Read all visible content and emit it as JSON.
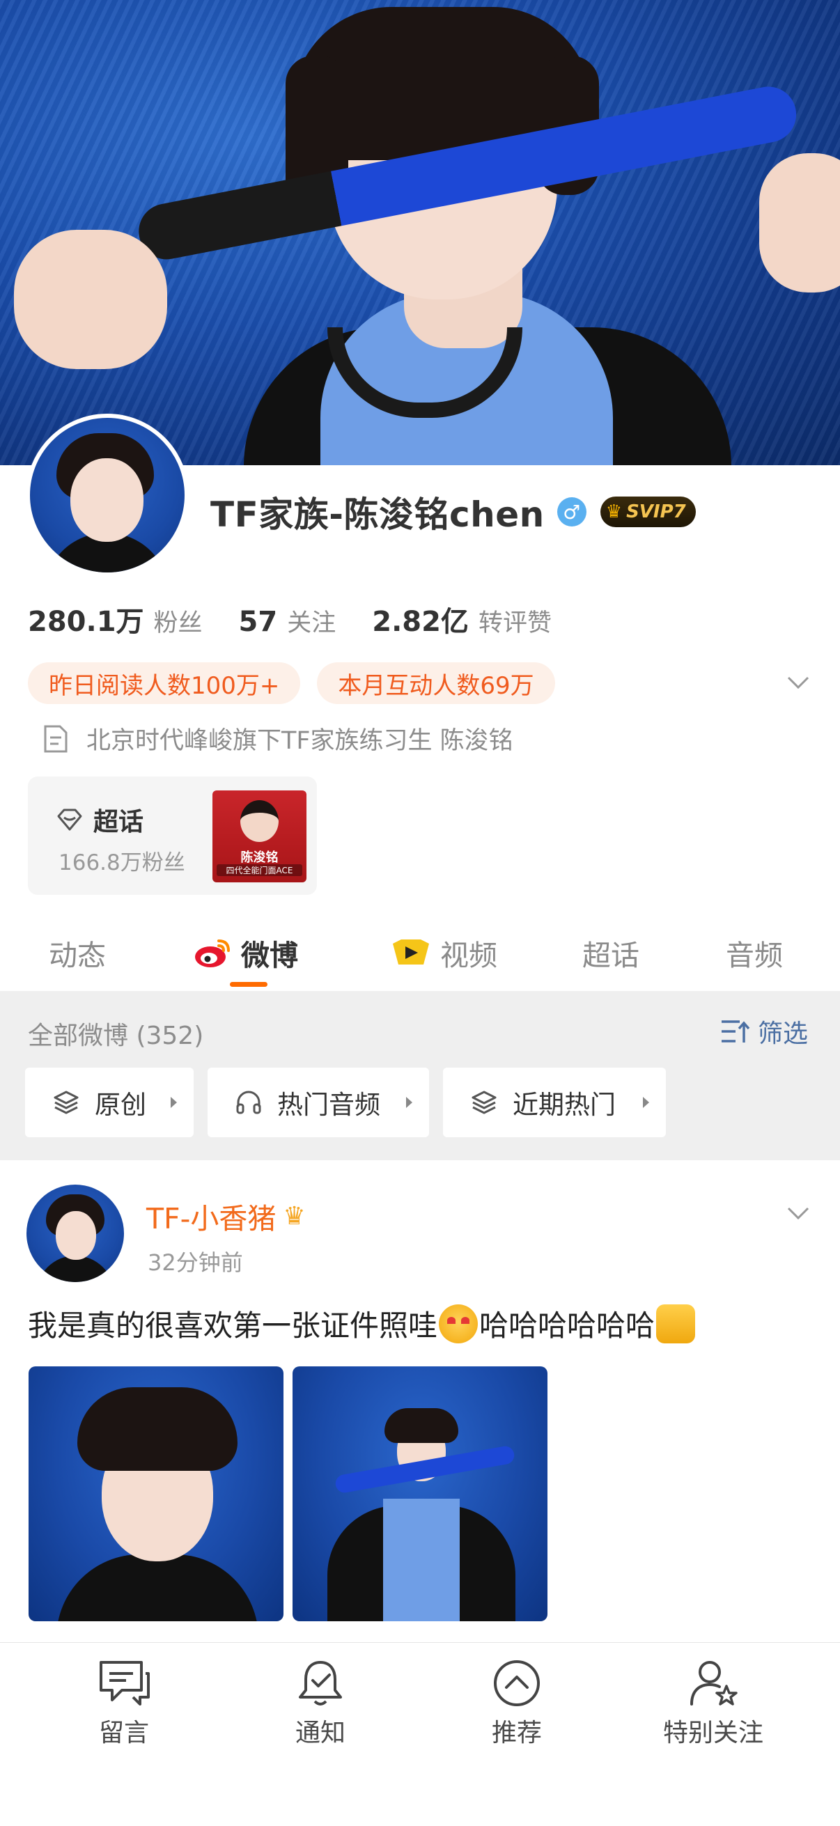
{
  "profile": {
    "name": "TF家族-陈浚铭chen",
    "gender_symbol": "♂",
    "vip_label": "SVIP7",
    "stats": [
      {
        "value": "280.1万",
        "label": "粉丝"
      },
      {
        "value": "57",
        "label": "关注"
      },
      {
        "value": "2.82亿",
        "label": "转评赞"
      }
    ],
    "tags": [
      "昨日阅读人数100万+",
      "本月互动人数69万"
    ],
    "bio": "北京时代峰峻旗下TF家族练习生  陈浚铭"
  },
  "supertopic": {
    "title": "超话",
    "fans": "166.8万粉丝",
    "thumb_name": "陈浚铭",
    "thumb_sub": "四代全能门面ACE"
  },
  "tabs": [
    "动态",
    "微博",
    "视频",
    "超话",
    "音频"
  ],
  "active_tab": "微博",
  "feed": {
    "title": "全部微博 (352)",
    "filter_label": "筛选",
    "chips": [
      "原创",
      "热门音频",
      "近期热门"
    ]
  },
  "post": {
    "author": "TF-小香猪",
    "time": "32分钟前",
    "text_part1": "我是真的很喜欢第一张证件照哇",
    "text_part2": "哈哈哈哈哈哈"
  },
  "bottom_nav": [
    "留言",
    "通知",
    "推荐",
    "特别关注"
  ],
  "colors": {
    "accent": "#ff6b00",
    "username": "#f26a1b",
    "tag_bg": "#fdf0e8",
    "tag_text": "#f05b1e",
    "filter_link": "#4b6fa3"
  },
  "icons": [
    "document-icon",
    "supertopic-icon",
    "weibo-icon",
    "video-icon",
    "filter-icon",
    "layers-icon",
    "headphones-icon",
    "chevron-down-icon",
    "comment-icon",
    "bell-icon",
    "up-arrow-circle-icon",
    "user-star-icon"
  ]
}
